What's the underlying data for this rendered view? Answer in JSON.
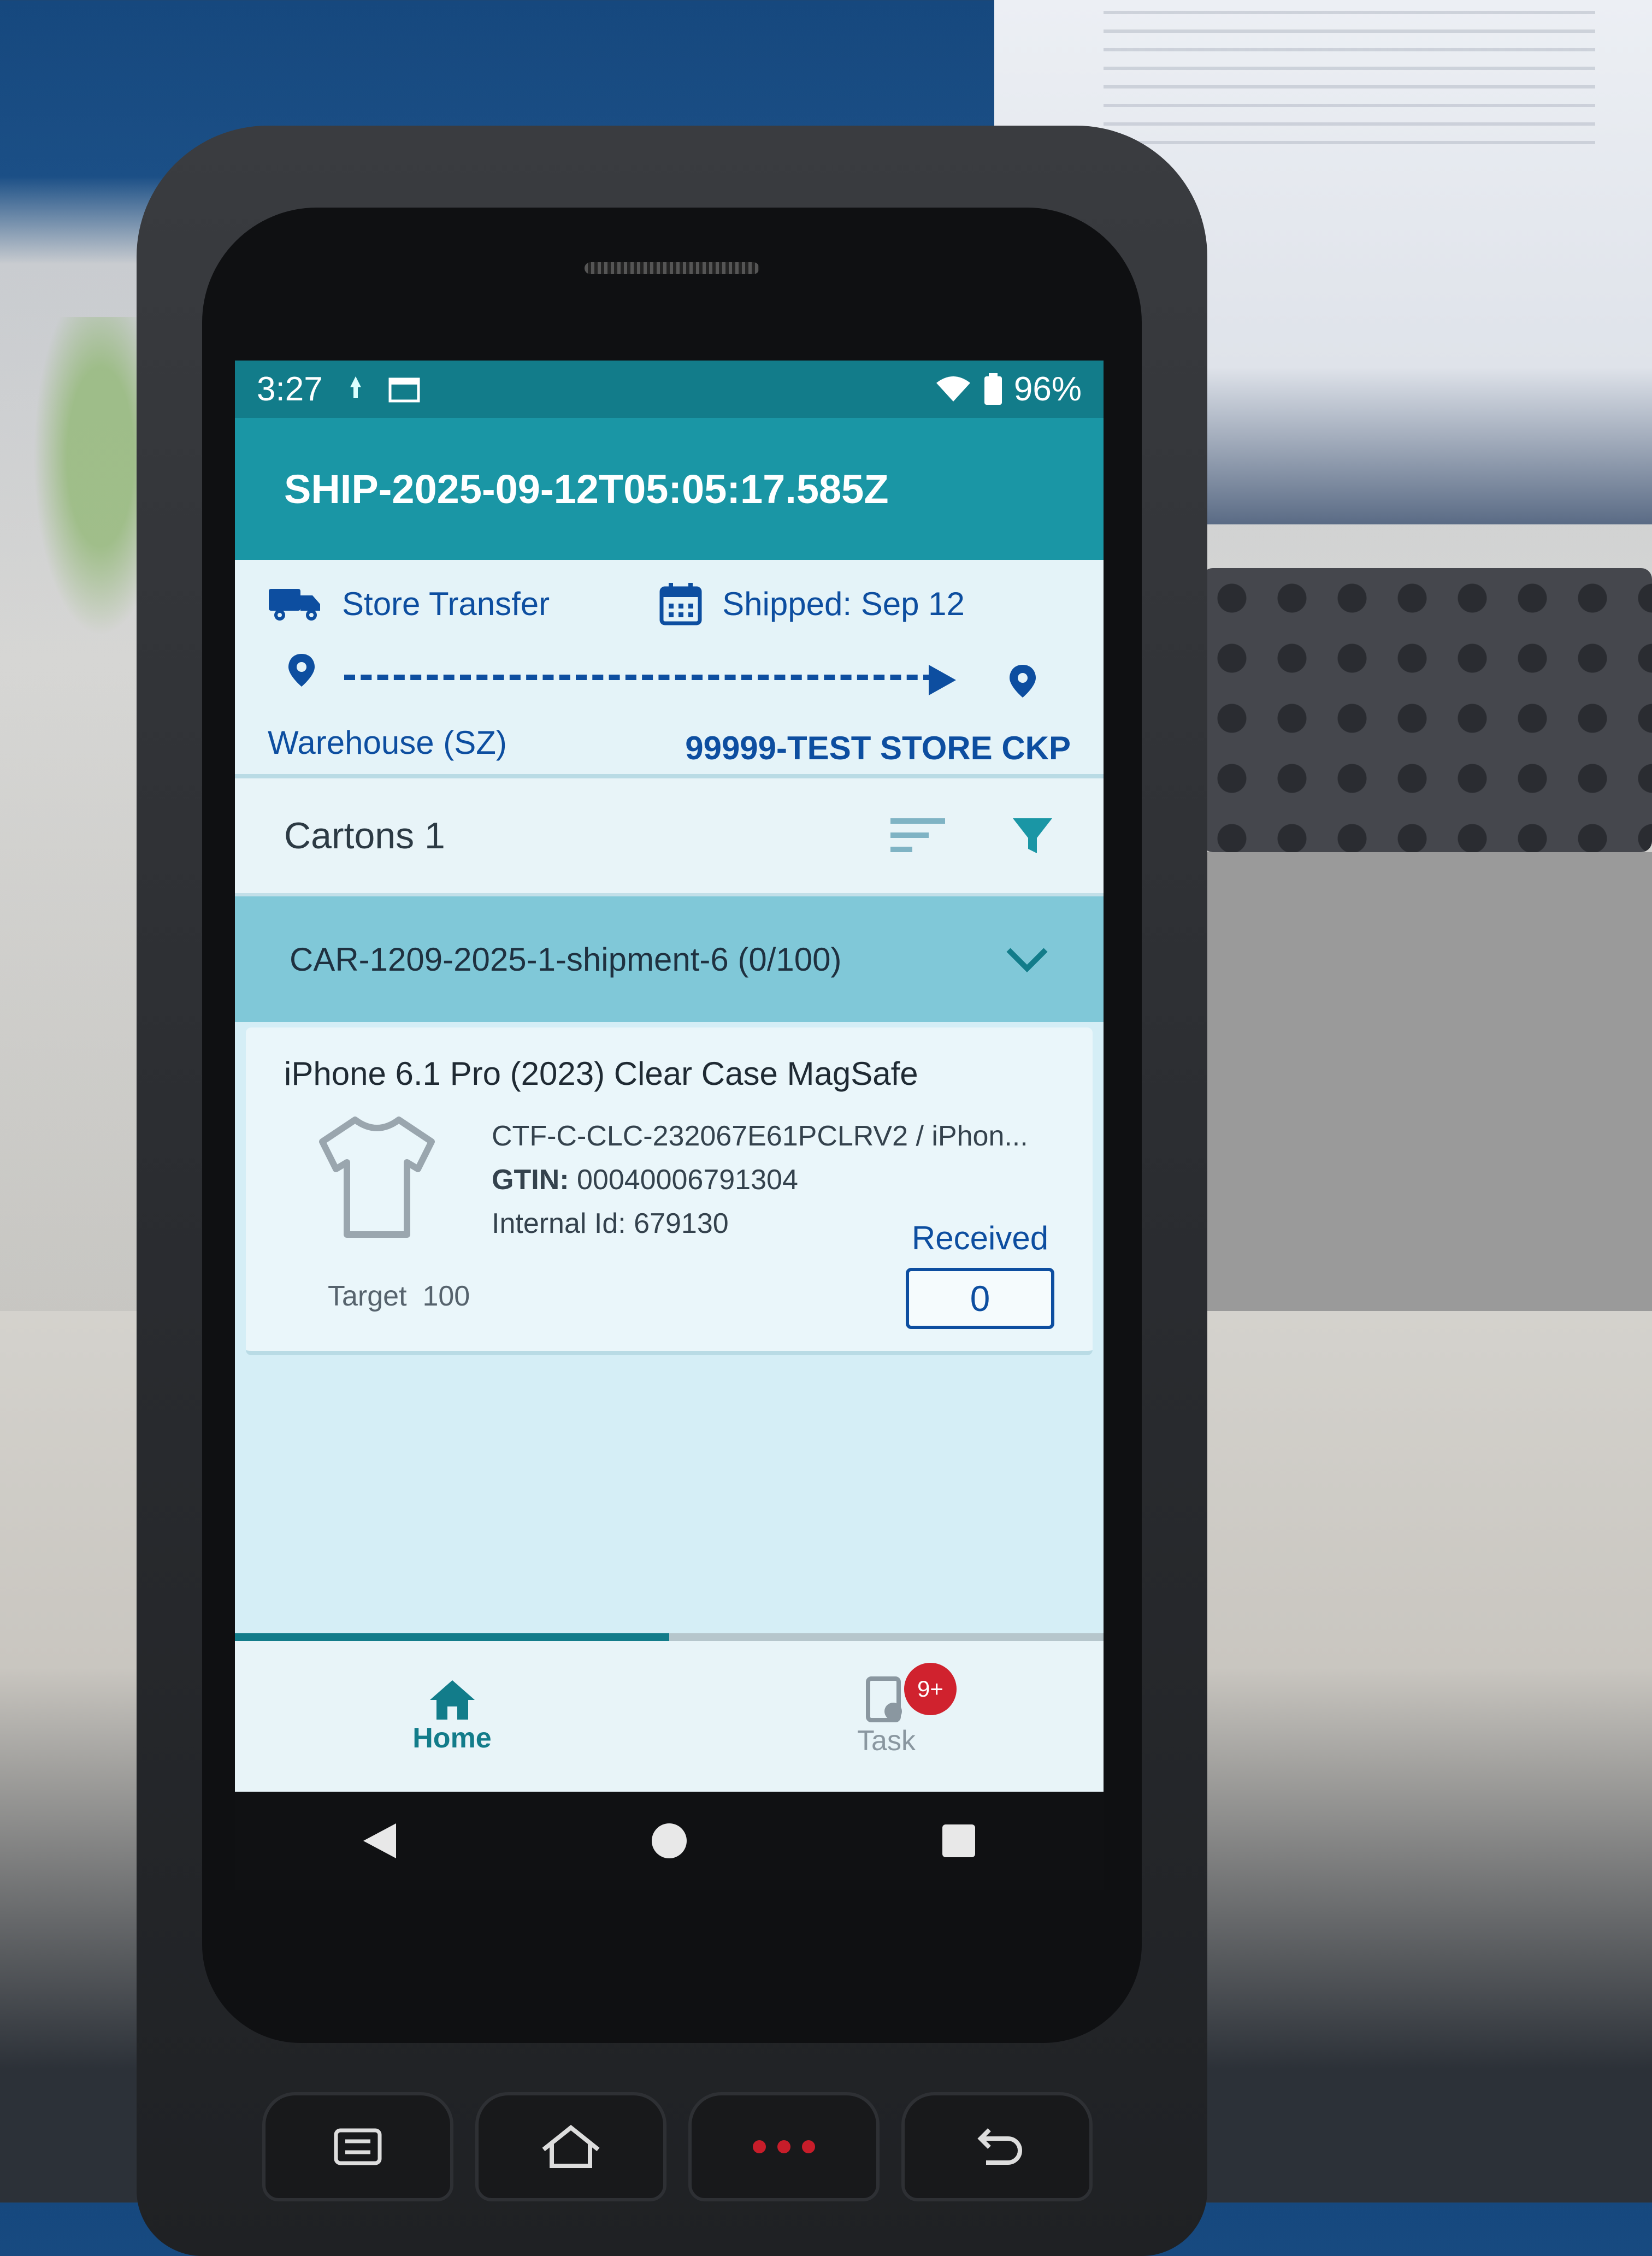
{
  "status_bar": {
    "time": "3:27",
    "battery": "96%",
    "icons": [
      "notification-icon",
      "calendar-icon",
      "wifi-icon",
      "battery-icon"
    ]
  },
  "app_bar": {
    "title": "SHIP-2025-09-12T05:05:17.585Z"
  },
  "shipment": {
    "type_label": "Store Transfer",
    "shipped_label": "Shipped: Sep 12",
    "origin": "Warehouse (SZ)",
    "destination": "99999-TEST STORE CKP"
  },
  "cartons": {
    "label": "Cartons 1",
    "carton_label": "CAR-1209-2025-1-shipment-6 (0/100)"
  },
  "item": {
    "title": "iPhone 6.1 Pro (2023) Clear Case MagSafe",
    "sku": "CTF-C-CLC-232067E61PCLRV2 / iPhon...",
    "gtin_label": "GTIN:",
    "gtin_value": "00040006791304",
    "internal_id_label": "Internal Id:",
    "internal_id_value": "679130",
    "target_label": "Target",
    "target_value": "100",
    "received_label": "Received",
    "received_value": "0"
  },
  "bottom_nav": {
    "progress": 0.5,
    "home_label": "Home",
    "task_label": "Task",
    "task_badge": "9+"
  },
  "colors": {
    "primary": "#1a96a5",
    "primary_dark": "#127c8a",
    "accent_blue": "#0d4ea0",
    "badge_red": "#d0222e"
  }
}
